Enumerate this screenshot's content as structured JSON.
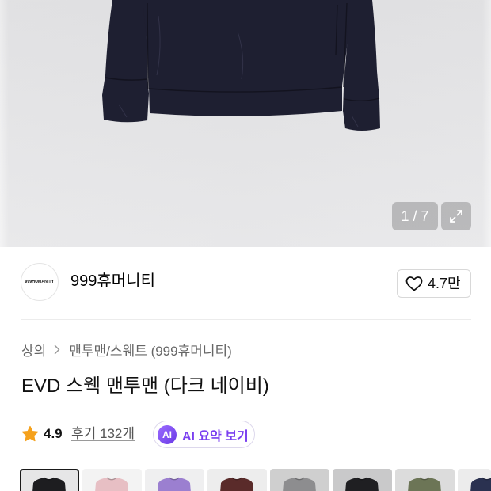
{
  "gallery": {
    "counter": "1 / 7"
  },
  "brand": {
    "logo_text": "999HUMANITY",
    "name": "999휴머니티",
    "likes": "4.7만"
  },
  "breadcrumb": {
    "category": "상의",
    "subcategory": "맨투맨/스웨트 (999휴머니티)"
  },
  "product": {
    "title": "EVD 스웩 맨투맨 (다크 네이비)",
    "rating": "4.9",
    "reviews": "후기 132개"
  },
  "ai_summary": {
    "badge": "AI",
    "label": "AI 요약 보기"
  },
  "swatches": {
    "selected_index": 0,
    "items": [
      {
        "color": "#1d1d20",
        "bg": "#e6e6e7"
      },
      {
        "color": "#e7bfc4",
        "bg": "#f3f3f3"
      },
      {
        "color": "#9b7fd0",
        "bg": "#efeff0"
      },
      {
        "color": "#5a2b2a",
        "bg": "#ededed"
      },
      {
        "color": "#8d8d8f",
        "bg": "#cfcfcf"
      },
      {
        "color": "#1f1f22",
        "bg": "#c9c9ca"
      },
      {
        "color": "#6c7556",
        "bg": "#dcdcdc"
      },
      {
        "color": "#2a3150",
        "bg": "#ececec"
      }
    ]
  },
  "icons": {
    "expand": "expand-icon",
    "like": "heart-outline-icon",
    "breadcrumb_separator": "chevron-right-icon",
    "rating": "star-icon"
  },
  "colors": {
    "product_navy": "#1e1f31",
    "star": "#f5a11c",
    "ai_purple": "#7a3ff0",
    "ai_gradient_start": "#9b6bff",
    "ai_gradient_end": "#6a3ae6",
    "text_primary": "#111111",
    "text_secondary": "#666666",
    "divider": "#ececec"
  }
}
